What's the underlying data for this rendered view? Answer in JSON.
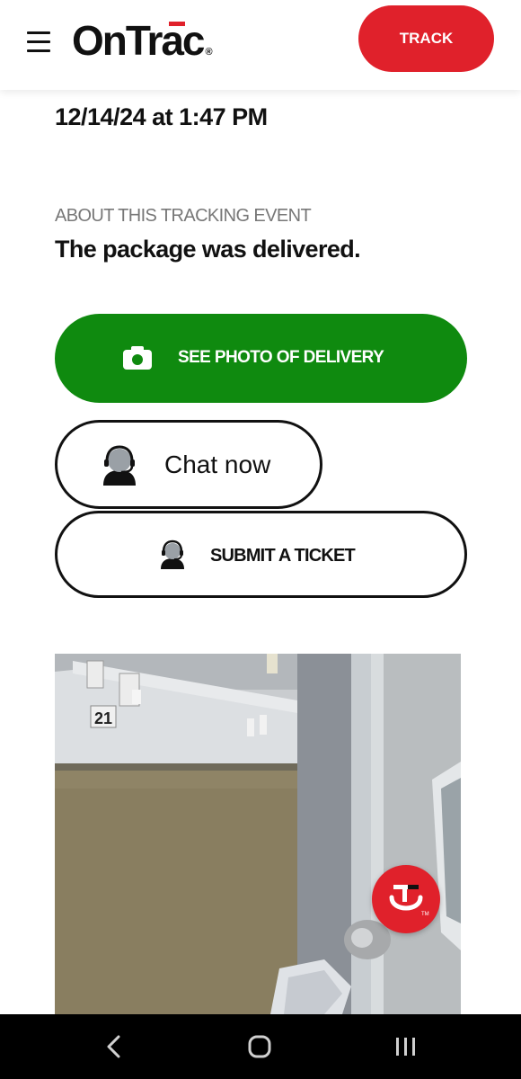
{
  "header": {
    "logo_text": "OnTrac",
    "logo_mark": "®",
    "menu_icon": "hamburger-menu-icon",
    "track_label": "TRACK"
  },
  "event": {
    "timestamp": "12/14/24 at 1:47 PM",
    "section_label": "ABOUT THIS TRACKING EVENT",
    "description": "The package was delivered."
  },
  "actions": {
    "photo_label": "SEE PHOTO OF DELIVERY",
    "photo_icon": "camera-icon",
    "chat_label": "Chat now",
    "chat_icon": "support-agent-icon",
    "ticket_label": "SUBMIT A TICKET",
    "ticket_icon": "support-agent-icon"
  },
  "photo": {
    "unit_number": "21"
  },
  "colors": {
    "brand_red": "#e0212b",
    "delivery_green": "#0f8a0f",
    "text_dark": "#111111",
    "label_gray": "#777777"
  },
  "system_nav": {
    "back_icon": "back-chevron-icon",
    "home_icon": "home-icon",
    "recents_icon": "recents-icon"
  }
}
